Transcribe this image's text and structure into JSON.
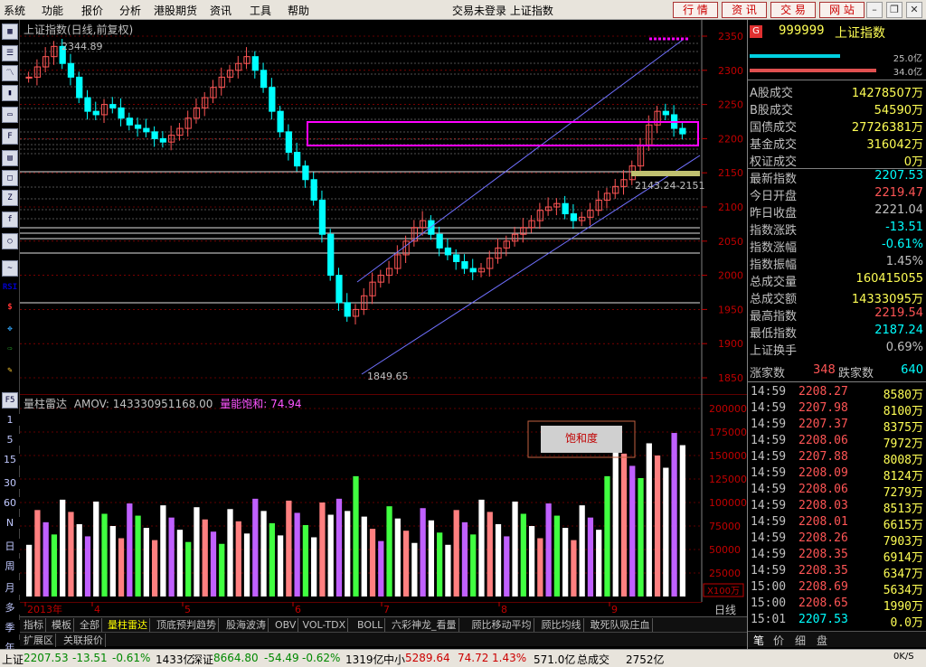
{
  "menu": [
    "系统",
    "功能",
    "报价",
    "分析",
    "港股期货",
    "资讯",
    "工具",
    "帮助"
  ],
  "window_title": "交易未登录  上证指数",
  "nav_buttons": [
    "行 情",
    "资 讯",
    "交 易",
    "网 站"
  ],
  "left_toolbar_labels": [
    "F5",
    "1",
    "5",
    "15",
    "30",
    "60",
    "N",
    "日",
    "周",
    "月",
    "多",
    "季",
    "年"
  ],
  "price_chart": {
    "title": "上证指数(日线,前复权)",
    "high_label": "2344.89",
    "low_label": "1849.65",
    "band_label": "2143.24-2151",
    "y_ticks": [
      "2350",
      "2300",
      "2250",
      "2200",
      "2150",
      "2100",
      "2050",
      "2000",
      "1950",
      "1900",
      "1850"
    ]
  },
  "volume_chart": {
    "title": "量柱雷达",
    "amov_label": "AMOV: 143330951168.00",
    "saturation_label": "量能饱和: 74.94",
    "box_label": "饱和度",
    "y_ticks": [
      "200000",
      "175000",
      "150000",
      "125000",
      "100000",
      "75000",
      "50000",
      "25000"
    ],
    "unit": "X100万"
  },
  "x_axis_labels": [
    "2013年",
    "4",
    "5",
    "6",
    "7",
    "8",
    "9"
  ],
  "period_label": "日线",
  "tabs": [
    "指标",
    "模板",
    "全部",
    "量柱雷达",
    "顶底预判趋势",
    "股海波涛",
    "OBV",
    "VOL-TDX",
    "BOLL",
    "六彩神龙_看量",
    "顾比移动平均",
    "顾比均线",
    "敢死队吸庄血"
  ],
  "subtabs": [
    "扩展区",
    "关联报价"
  ],
  "quote": {
    "code": "999999",
    "name": "上证指数",
    "bar1_value": "25.0亿",
    "bar2_value": "34.0亿",
    "rows": [
      {
        "label": "A股成交",
        "value": "14278507万"
      },
      {
        "label": "B股成交",
        "value": "54590万"
      },
      {
        "label": "国债成交",
        "value": "27726381万"
      },
      {
        "label": "基金成交",
        "value": "316042万"
      },
      {
        "label": "权证成交",
        "value": "0万"
      },
      {
        "label": "最新指数",
        "value": "2207.53"
      },
      {
        "label": "今日开盘",
        "value": "2219.47"
      },
      {
        "label": "昨日收盘",
        "value": "2221.04"
      },
      {
        "label": "指数涨跌",
        "value": "-13.51"
      },
      {
        "label": "指数涨幅",
        "value": "-0.61%"
      },
      {
        "label": "指数振幅",
        "value": "1.45%"
      },
      {
        "label": "总成交量",
        "value": "160415055"
      },
      {
        "label": "总成交额",
        "value": "14333095万"
      },
      {
        "label": "最高指数",
        "value": "2219.54"
      },
      {
        "label": "最低指数",
        "value": "2187.24"
      },
      {
        "label": "上证换手",
        "value": "0.69%"
      }
    ],
    "up_label": "涨家数",
    "up_count": "348",
    "down_label": "跌家数",
    "down_count": "640"
  },
  "ticks": [
    {
      "t": "14:59",
      "p": "2208.27",
      "v": "8580万"
    },
    {
      "t": "14:59",
      "p": "2207.98",
      "v": "8100万"
    },
    {
      "t": "14:59",
      "p": "2207.37",
      "v": "8375万"
    },
    {
      "t": "14:59",
      "p": "2208.06",
      "v": "7972万"
    },
    {
      "t": "14:59",
      "p": "2207.88",
      "v": "8008万"
    },
    {
      "t": "14:59",
      "p": "2208.09",
      "v": "8124万"
    },
    {
      "t": "14:59",
      "p": "2208.06",
      "v": "7279万"
    },
    {
      "t": "14:59",
      "p": "2208.03",
      "v": "8513万"
    },
    {
      "t": "14:59",
      "p": "2208.01",
      "v": "6615万"
    },
    {
      "t": "14:59",
      "p": "2208.26",
      "v": "7903万"
    },
    {
      "t": "14:59",
      "p": "2208.35",
      "v": "6914万"
    },
    {
      "t": "14:59",
      "p": "2208.35",
      "v": "6347万"
    },
    {
      "t": "15:00",
      "p": "2208.69",
      "v": "5634万"
    },
    {
      "t": "15:00",
      "p": "2208.65",
      "v": "1990万"
    },
    {
      "t": "15:01",
      "p": "2207.53",
      "v": "0.0万"
    }
  ],
  "right_tabs": [
    "笔",
    "价",
    "细",
    "盘"
  ],
  "status": {
    "sh_label": "上证",
    "sh_value": "2207.53",
    "sh_change": "-13.51",
    "sh_pct": "-0.61%",
    "sh_amount": "1433亿",
    "sz_label": "深证",
    "sz_value": "8664.80",
    "sz_change": "-54.49",
    "sz_pct": "-0.62%",
    "sz_amount": "1319亿",
    "zx_label": "中小",
    "zx_value": "5289.64",
    "zx_change": "74.72",
    "zx_pct": "1.43%",
    "zx_amount": "571.0亿",
    "total_label": "总成交",
    "total_value": "2752亿",
    "net_speed": "0K/S"
  },
  "colors": {
    "up": "#ff5555",
    "down": "#00ffff",
    "bg": "#000000",
    "yellow": "#ffff55",
    "magenta": "#ff00ff"
  }
}
